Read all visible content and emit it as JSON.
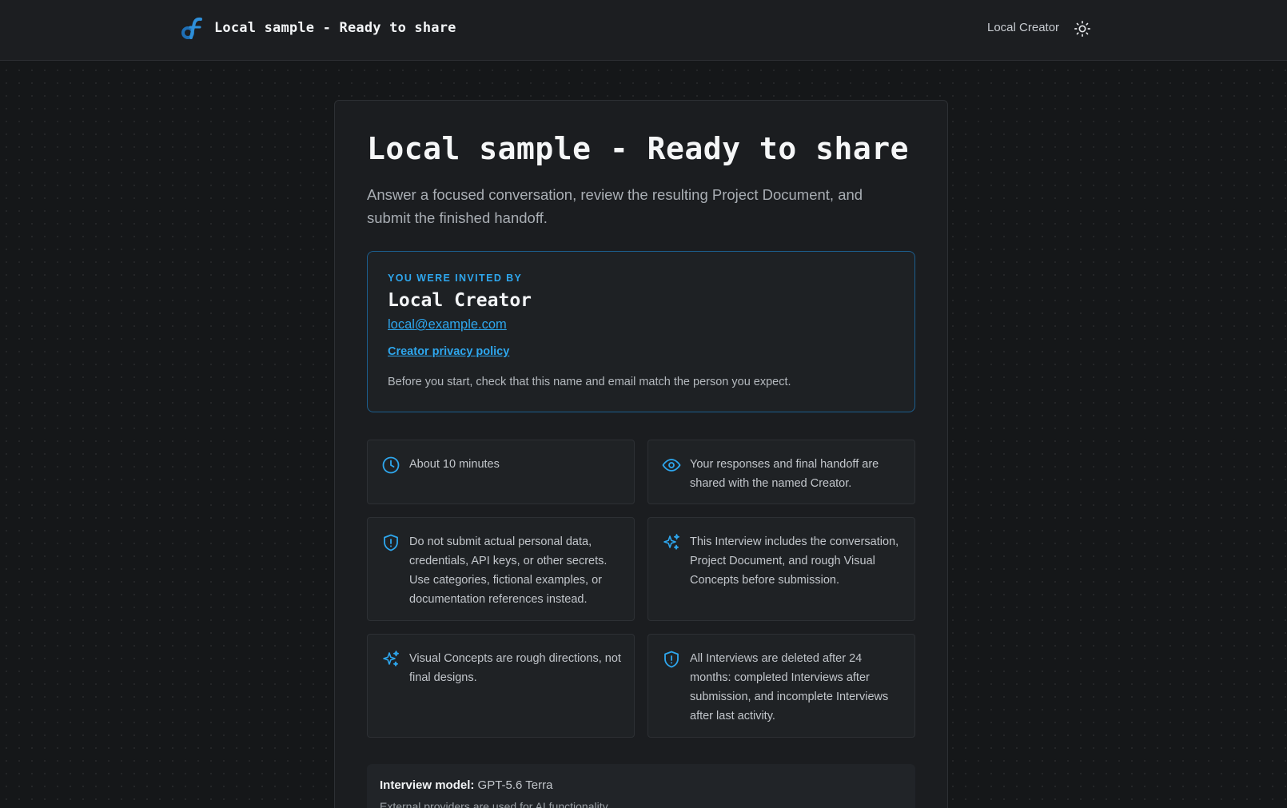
{
  "header": {
    "title": "Local sample - Ready to share",
    "creator": "Local Creator",
    "logo_icon": "brand-logo-icon",
    "theme_icon": "sun-icon"
  },
  "main": {
    "title": "Local sample - Ready to share",
    "subtitle": "Answer a focused conversation, review the resulting Project Document, and submit the finished handoff."
  },
  "invite": {
    "kicker": "YOU WERE INVITED BY",
    "name": "Local Creator",
    "email": "local@example.com",
    "policy": "Creator privacy policy",
    "note": "Before you start, check that this name and email match the person you expect."
  },
  "info": [
    {
      "icon": "clock-icon",
      "text": "About 10 minutes"
    },
    {
      "icon": "eye-icon",
      "text": "Your responses and final handoff are shared with the named Creator."
    },
    {
      "icon": "shield-icon",
      "text": "Do not submit actual personal data, credentials, API keys, or other secrets. Use categories, fictional examples, or documentation references instead."
    },
    {
      "icon": "sparkles-icon",
      "text": "This Interview includes the conversation, Project Document, and rough Visual Concepts before submission."
    },
    {
      "icon": "sparkles-icon",
      "text": "Visual Concepts are rough directions, not final designs."
    },
    {
      "icon": "shield-icon",
      "text": "All Interviews are deleted after 24 months: completed Interviews after submission, and incomplete Interviews after last activity."
    }
  ],
  "model": {
    "label": "Interview model:",
    "value": "GPT-5.6 Terra",
    "note": "External providers are used for AI functionality."
  },
  "colors": {
    "accent": "#2ea7ee",
    "background": "#151719",
    "card": "#1b1d20"
  }
}
